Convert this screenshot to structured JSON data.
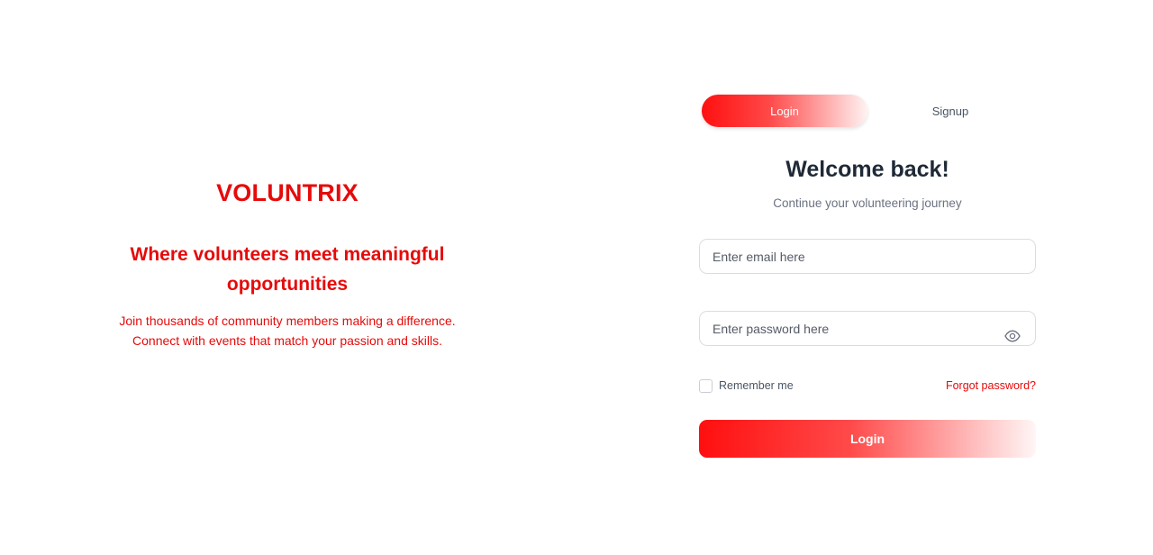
{
  "brand": {
    "name": "VOLUNTRIX",
    "tagline": "Where volunteers meet meaningful opportunities",
    "description_line1": "Join thousands of community members making a difference.",
    "description_line2": "Connect with events that match your passion and skills."
  },
  "tabs": [
    {
      "label": "Login",
      "active": true
    },
    {
      "label": "Signup",
      "active": false
    }
  ],
  "form": {
    "heading": "Welcome back!",
    "subheading": "Continue your volunteering journey",
    "email_placeholder": "Enter email here",
    "password_placeholder": "Enter password here",
    "remember_label": "Remember me",
    "remember_checked": false,
    "forgot_label": "Forgot password?",
    "submit_label": "Login"
  },
  "icons": {
    "password_toggle": "eye-icon"
  },
  "colors": {
    "accent": "#e60a0a",
    "heading": "#1f2937",
    "muted": "#6b7280"
  }
}
